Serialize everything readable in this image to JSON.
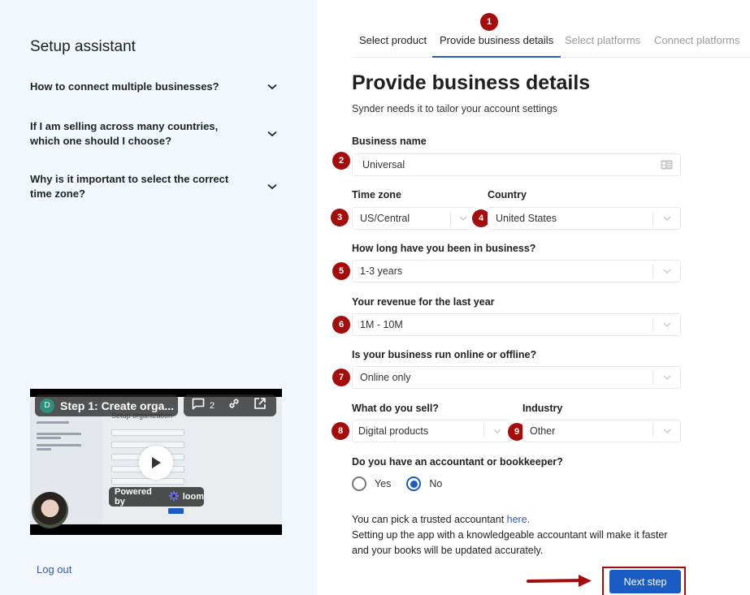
{
  "sidebar": {
    "title": "Setup assistant",
    "faqs": [
      {
        "question": "How to connect multiple businesses?"
      },
      {
        "question": "If I am selling across many countries, which one should I choose?"
      },
      {
        "question": "Why is it important to select the correct time zone?"
      }
    ],
    "video": {
      "avatar_letter": "D",
      "title": "Step 1: Create orga...",
      "comment_count": "2",
      "powered_by": "Powered by",
      "brand": "loom",
      "preview_heading": "Setup organization"
    },
    "logout_label": "Log out"
  },
  "tabs": [
    {
      "label": "Select product",
      "state": "done"
    },
    {
      "label": "Provide business details",
      "state": "active"
    },
    {
      "label": "Select platforms",
      "state": "disabled"
    },
    {
      "label": "Connect platforms",
      "state": "disabled"
    }
  ],
  "annotations": [
    "1",
    "2",
    "3",
    "4",
    "5",
    "6",
    "7",
    "8",
    "9"
  ],
  "form": {
    "title": "Provide business details",
    "subtitle": "Synder needs it to tailor your account settings",
    "business_name": {
      "label": "Business name",
      "value": "Universal"
    },
    "time_zone": {
      "label": "Time zone",
      "value": "US/Central"
    },
    "country": {
      "label": "Country",
      "value": "United States"
    },
    "business_age": {
      "label": "How long have you been in business?",
      "value": "1-3 years"
    },
    "revenue": {
      "label": "Your revenue for the last year",
      "value": "1M - 10M"
    },
    "online_offline": {
      "label": "Is your business run online or offline?",
      "value": "Online only"
    },
    "what_sell": {
      "label": "What do you sell?",
      "value": "Digital products"
    },
    "industry": {
      "label": "Industry",
      "value": "Other"
    },
    "accountant": {
      "label": "Do you have an accountant or bookkeeper?",
      "options": [
        {
          "label": "Yes",
          "checked": false
        },
        {
          "label": "No",
          "checked": true
        }
      ]
    },
    "info_line1": "You can pick a trusted accountant ",
    "info_link": "here.",
    "info_line2": "Setting up the app with a knowledgeable accountant will make it faster and your books will be updated accurately.",
    "next_label": "Next step"
  },
  "colors": {
    "accent": "#1a5bc4",
    "annotation": "#a50d0d",
    "sidebar_bg": "#f3f7fe"
  }
}
